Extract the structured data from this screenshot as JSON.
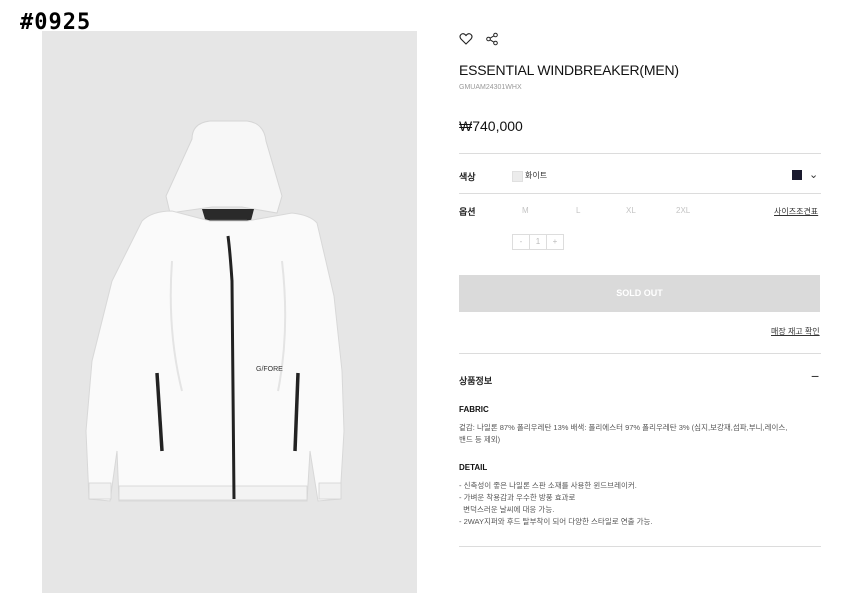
{
  "tag": "#0925",
  "product": {
    "title": "ESSENTIAL WINDBREAKER(MEN)",
    "code": "GMUAM24301WHX",
    "price": "₩740,000",
    "image_brand": "G/FORE"
  },
  "icons": {
    "wishlist": "heart-icon",
    "share": "share-icon"
  },
  "color": {
    "label": "색상",
    "selected_name": "화이트",
    "swatches": [
      "#ececec",
      "#1a1a2e"
    ]
  },
  "option": {
    "label": "옵션",
    "sizes": [
      "M",
      "L",
      "XL",
      "2XL"
    ],
    "size_guide": "사이즈조견표",
    "quantity": {
      "minus": "-",
      "value": "1",
      "plus": "+"
    }
  },
  "actions": {
    "sold_out": "SOLD OUT",
    "store_stock": "매장 재고 확인"
  },
  "details": {
    "section_title": "상품정보",
    "collapse_symbol": "−",
    "fabric_title": "FABRIC",
    "fabric_lines": [
      "겉감: 나일론 87% 폴리우레탄 13% 배색: 폴리에스터 97% 폴리우레탄 3% (심지,보강재,섬파,부니,레이스,",
      "밴드 등 제외)"
    ],
    "detail_title": "DETAIL",
    "detail_lines": [
      "- 신축성이 좋은 나일론 스판 소재를 사용한 윈드브레이커.",
      "- 가벼운 착용감과 우수한 방풍 효과로",
      "  변덕스러운 날씨에 대응 가능.",
      "- 2WAY지퍼와 후드 탈부착이 되어 다양한 스타일로 연출 가능."
    ]
  }
}
